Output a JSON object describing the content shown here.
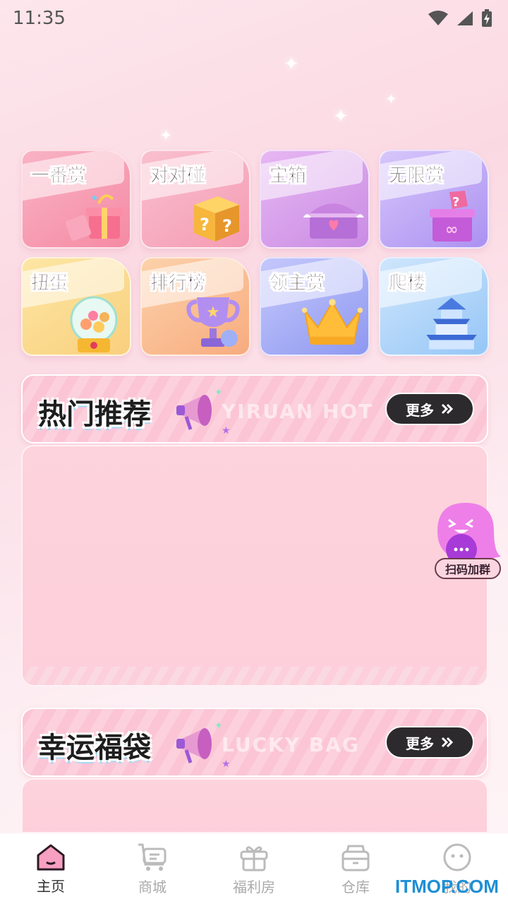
{
  "status_bar": {
    "time": "11:35"
  },
  "categories": [
    {
      "label": "一番赏",
      "icon": "gift-box-icon",
      "color": "pink"
    },
    {
      "label": "对对碰",
      "icon": "mystery-box-icon",
      "color": "pink2"
    },
    {
      "label": "宝箱",
      "icon": "treasure-chest-icon",
      "color": "violet"
    },
    {
      "label": "无限赏",
      "icon": "question-gift-icon",
      "color": "purple"
    },
    {
      "label": "扭蛋",
      "icon": "gacha-machine-icon",
      "color": "yellow"
    },
    {
      "label": "排行榜",
      "icon": "trophy-icon",
      "color": "orange"
    },
    {
      "label": "领主赏",
      "icon": "crown-icon",
      "color": "blue"
    },
    {
      "label": "爬楼",
      "icon": "tower-icon",
      "color": "sky"
    }
  ],
  "hot_section": {
    "title": "热门推荐",
    "subtitle_en": "YIRUAN  HOT",
    "more_label": "更多"
  },
  "lucky_section": {
    "title": "幸运福袋",
    "subtitle_en": "LUCKY BAG",
    "more_label": "更多"
  },
  "float_button": {
    "label": "扫码加群"
  },
  "tabbar": {
    "tabs": [
      {
        "label": "主页",
        "icon": "home-icon",
        "active": true
      },
      {
        "label": "商城",
        "icon": "cart-icon",
        "active": false
      },
      {
        "label": "福利房",
        "icon": "gift-icon",
        "active": false
      },
      {
        "label": "仓库",
        "icon": "box-icon",
        "active": false
      },
      {
        "label": "我的",
        "icon": "profile-icon",
        "active": false
      }
    ]
  },
  "watermark": "ITMOP.COM"
}
